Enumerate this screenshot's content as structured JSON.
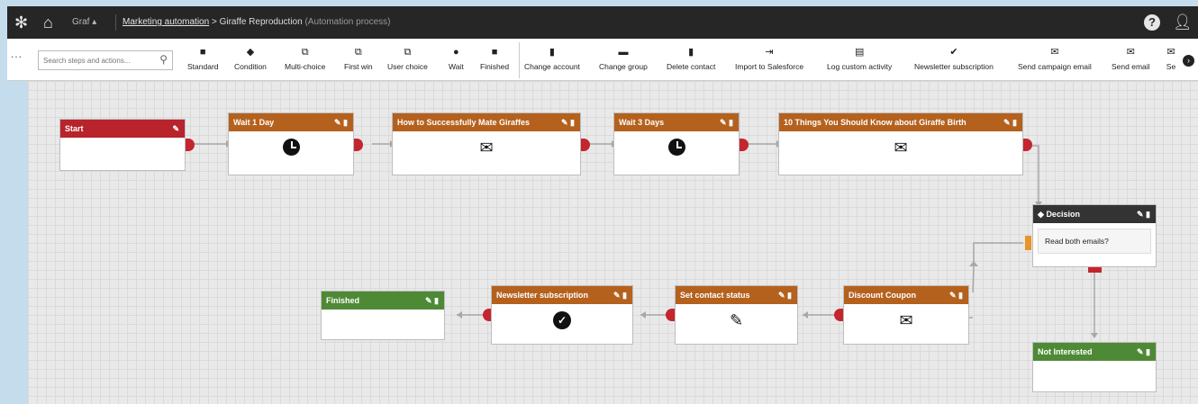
{
  "header": {
    "site": "Graf",
    "breadcrumb_link": "Marketing automation",
    "separator": ">",
    "process_name": "Giraffe Reproduction",
    "process_type": "(Automation process)",
    "help_icon": "question-icon",
    "user_icon": "user-icon"
  },
  "toolbar": {
    "more": "...",
    "search_placeholder": "Search steps and actions...",
    "items": [
      {
        "label": "Standard",
        "icon": "square-icon"
      },
      {
        "label": "Condition",
        "icon": "diamond-icon"
      },
      {
        "label": "Multi-choice",
        "icon": "multi-choice-icon"
      },
      {
        "label": "First win",
        "icon": "first-win-icon"
      },
      {
        "label": "User choice",
        "icon": "user-choice-icon"
      },
      {
        "label": "Wait",
        "icon": "clock-icon"
      },
      {
        "label": "Finished",
        "icon": "square-icon"
      },
      {
        "label": "Change account",
        "icon": "building-icon"
      },
      {
        "label": "Change group",
        "icon": "group-icon"
      },
      {
        "label": "Delete contact",
        "icon": "trash-icon"
      },
      {
        "label": "Import to Salesforce",
        "icon": "import-icon"
      },
      {
        "label": "Log custom activity",
        "icon": "log-icon"
      },
      {
        "label": "Newsletter subscription",
        "icon": "check-circle-icon"
      },
      {
        "label": "Send campaign email",
        "icon": "envelope-icon"
      },
      {
        "label": "Send email",
        "icon": "envelope-icon"
      },
      {
        "label": "Se",
        "icon": "envelope-icon"
      }
    ]
  },
  "nodes": {
    "start": {
      "title": "Start"
    },
    "wait1": {
      "title": "Wait 1 Day"
    },
    "email1": {
      "title": "How to Successfully Mate Giraffes"
    },
    "wait3": {
      "title": "Wait 3 Days"
    },
    "email2": {
      "title": "10 Things You Should Know about Giraffe Birth"
    },
    "decision": {
      "title": "Decision",
      "condition": "Read both emails?"
    },
    "not_interested": {
      "title": "Not Interested"
    },
    "discount": {
      "title": "Discount Coupon"
    },
    "contact_status": {
      "title": "Set contact status"
    },
    "newsletter": {
      "title": "Newsletter subscription"
    },
    "finished": {
      "title": "Finished"
    }
  },
  "colors": {
    "start": "#b8232c",
    "action": "#b5611e",
    "decision": "#333333",
    "finish": "#4e8a35"
  }
}
